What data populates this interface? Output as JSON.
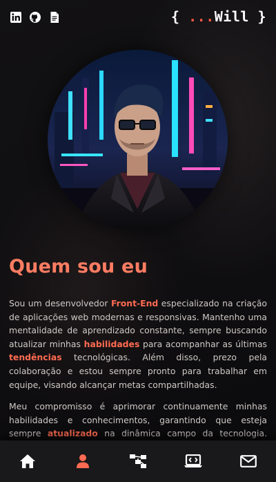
{
  "header": {
    "brand_open": "{ ",
    "brand_dots": "...",
    "brand_name": "Will",
    "brand_close": " }",
    "social_icons": [
      "linkedin-icon",
      "github-icon",
      "document-icon"
    ]
  },
  "about": {
    "title": "Quem sou eu",
    "p1": [
      {
        "text": "Sou um desenvolvedor ",
        "hl": false
      },
      {
        "text": "Front-End",
        "hl": true
      },
      {
        "text": " especializado na criação de aplicações web modernas e responsivas. Mantenho uma mentalidade de aprendizado constante, sempre buscando atualizar minhas ",
        "hl": false
      },
      {
        "text": "habilidades",
        "hl": true
      },
      {
        "text": " para acompanhar as últimas ",
        "hl": false
      },
      {
        "text": "tendências",
        "hl": true
      },
      {
        "text": " tecnológicas. Além disso, prezo pela colaboração e estou sempre pronto para trabalhar em equipe, visando alcançar metas compartilhadas.",
        "hl": false
      }
    ],
    "p2": [
      {
        "text": "Meu compromisso é aprimorar continuamente minhas habilidades e conhecimentos, garantindo que esteja sempre ",
        "hl": false
      },
      {
        "text": "atualizado",
        "hl": true
      },
      {
        "text": " na dinâmica campo da tecnologia. Estou confiante",
        "hl": false
      }
    ]
  },
  "nav": {
    "items": [
      "home-icon",
      "user-icon",
      "sitemap-icon",
      "laptop-code-icon",
      "mail-icon"
    ],
    "active": "user-icon"
  },
  "colors": {
    "accent": "#ff6b52",
    "background": "#0e0d0f",
    "nav_bg": "#19181a"
  }
}
